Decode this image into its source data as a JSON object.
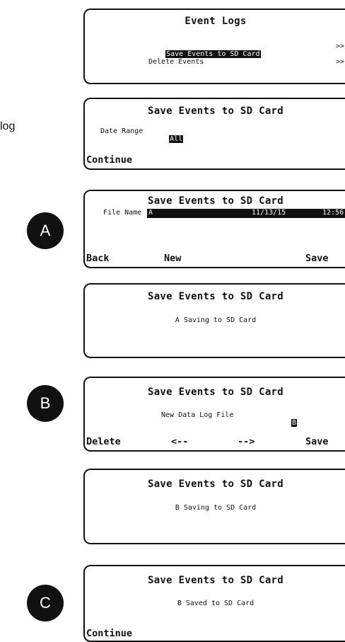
{
  "side_text": "log",
  "badges": {
    "a": "A",
    "b": "B",
    "c": "C"
  },
  "screens": {
    "event_logs": {
      "title": "Event Logs",
      "items": [
        {
          "label": "Save Events to SD Card",
          "arrow": ">>"
        },
        {
          "label": "Delete Events",
          "arrow": ">>"
        }
      ]
    },
    "save_date": {
      "title": "Save Events to SD Card",
      "date_label": "Date Range",
      "date_value": "All",
      "continue": "Continue"
    },
    "save_file": {
      "title": "Save Events to SD Card",
      "file_label": "File Name",
      "file_name": "A",
      "file_date": "11/13/15",
      "file_time": "12:56",
      "back": "Back",
      "new": "New",
      "save": "Save"
    },
    "saving_a": {
      "title": "Save Events to SD Card",
      "message": "A Saving to SD Card"
    },
    "new_file": {
      "title": "Save Events to SD Card",
      "label": "New Data Log File",
      "value": "B",
      "delete": "Delete",
      "left": "<--",
      "right": "-->",
      "save": "Save"
    },
    "saving_b": {
      "title": "Save Events to SD Card",
      "message": "B Saving to SD Card"
    },
    "saved_b": {
      "title": "Save Events to SD Card",
      "message": "B Saved to SD Card",
      "continue": "Continue"
    }
  }
}
